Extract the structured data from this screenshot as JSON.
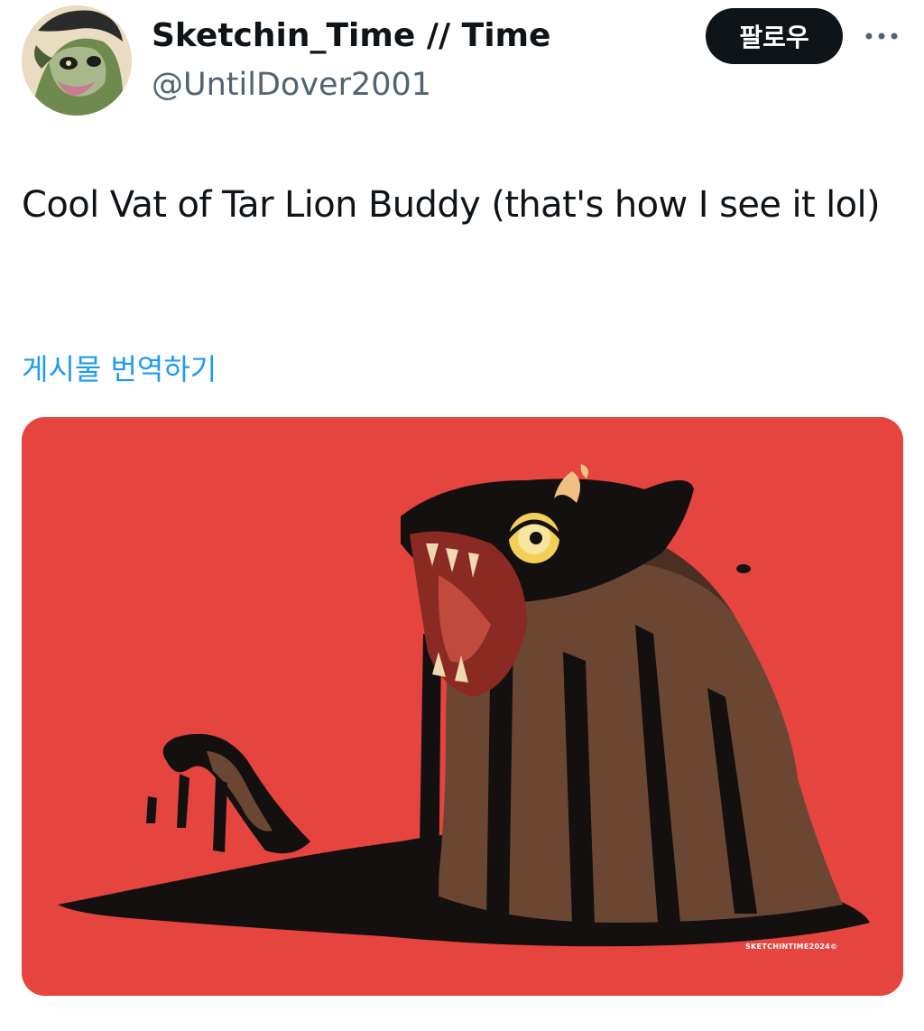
{
  "tweet": {
    "author": {
      "display_name": "Sketchin_Time // Time",
      "handle": "@UntilDover2001"
    },
    "follow_label": "팔로우",
    "text": "Cool Vat of Tar Lion Buddy (that's how I see it lol)",
    "translate_label": "게시물 번역하기",
    "media": {
      "signature": "SKETCHINTIME2024©"
    }
  },
  "colors": {
    "follow_button_bg": "#0f1419",
    "link": "#1d9bf0",
    "secondary_text": "#536471",
    "artwork_background": "#e5443f"
  },
  "icons": {
    "more": "more-horizontal-icon"
  }
}
